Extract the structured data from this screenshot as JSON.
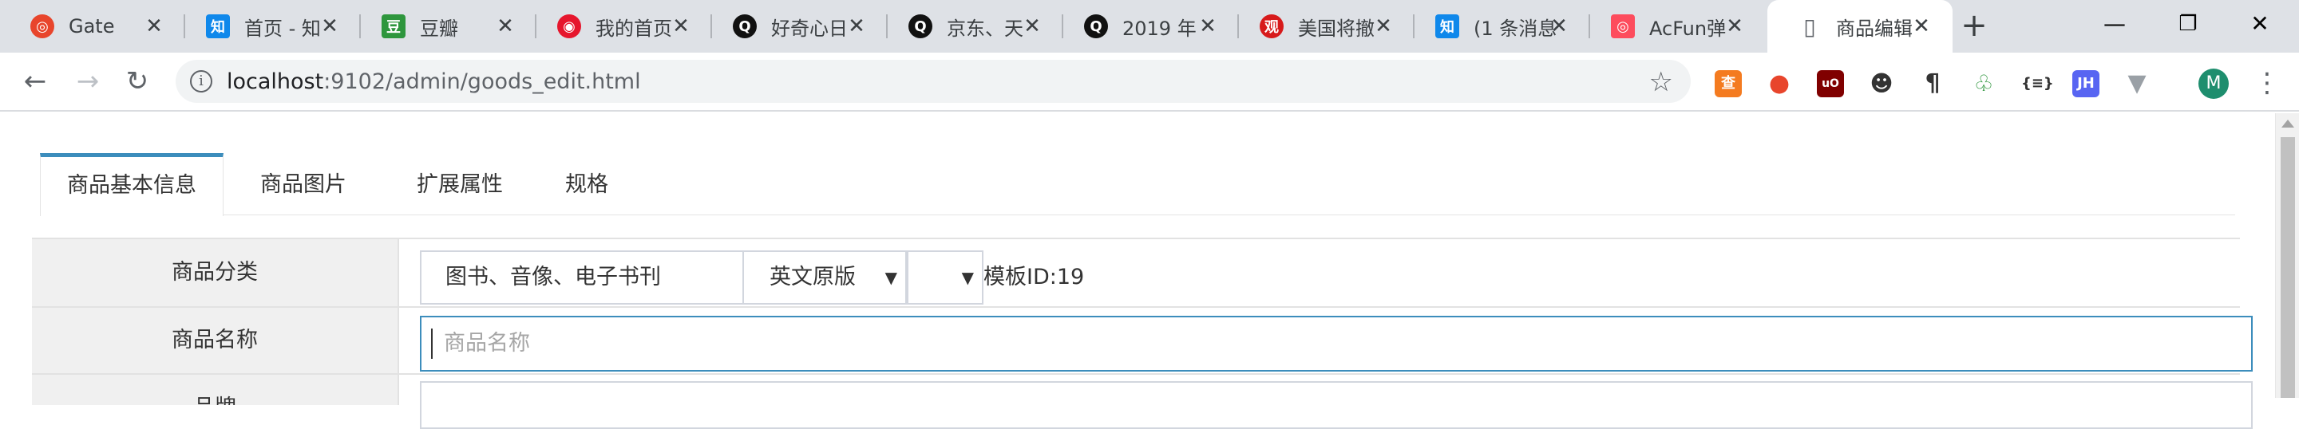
{
  "browser": {
    "tabs": [
      {
        "title": "Gate",
        "icon": "gate-favicon",
        "color": "#e8452c",
        "glyph": "◎"
      },
      {
        "title": "首页 - 知",
        "icon": "zhihu-favicon",
        "color": "#0f88eb",
        "glyph": "知"
      },
      {
        "title": "豆瓣",
        "icon": "douban-favicon",
        "color": "#2e963d",
        "glyph": "豆"
      },
      {
        "title": "我的首页",
        "icon": "weibo-favicon",
        "color": "#e6162d",
        "glyph": "◉"
      },
      {
        "title": "好奇心日",
        "icon": "qdaily-favicon",
        "color": "#111111",
        "glyph": "Q"
      },
      {
        "title": "京东、天",
        "icon": "qdaily-favicon",
        "color": "#111111",
        "glyph": "Q"
      },
      {
        "title": "2019 年",
        "icon": "qdaily-favicon",
        "color": "#111111",
        "glyph": "Q"
      },
      {
        "title": "美国将撤",
        "icon": "guancha-favicon",
        "color": "#d71a1b",
        "glyph": "观"
      },
      {
        "title": "(1 条消息",
        "icon": "zhihu-favicon",
        "color": "#0f88eb",
        "glyph": "知"
      },
      {
        "title": "AcFun弹",
        "icon": "acfun-favicon",
        "color": "#fd4c5d",
        "glyph": "◎"
      },
      {
        "title": "商品编辑",
        "icon": "document-icon",
        "color": "#5f6368",
        "glyph": "▯"
      }
    ],
    "url_host": "localhost",
    "url_path": ":9102/admin/goods_edit.html",
    "avatar_letter": "M"
  },
  "page": {
    "tabs": [
      "商品基本信息",
      "商品图片",
      "扩展属性",
      "规格"
    ],
    "category_label": "商品分类",
    "category1": "图书、音像、电子书刊",
    "category2": "英文原版",
    "category3": "",
    "template": "模板ID:19",
    "name_label": "商品名称",
    "name_placeholder": "商品名称",
    "brand_label": "品牌"
  }
}
